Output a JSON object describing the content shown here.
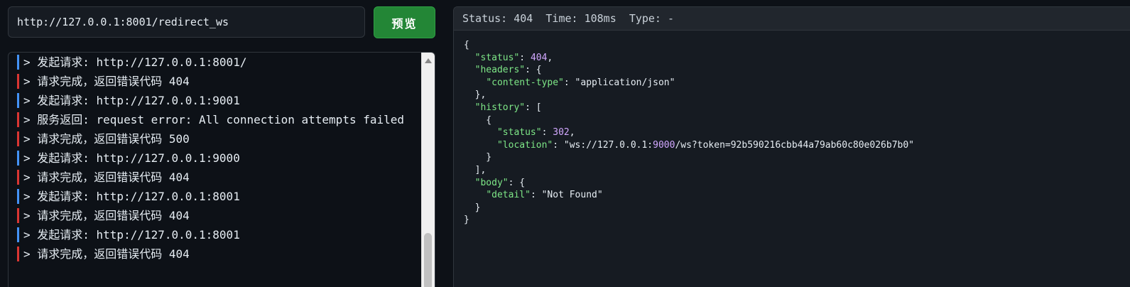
{
  "url_input": {
    "value": "http://127.0.0.1:8001/redirect_ws"
  },
  "preview_button": {
    "label": "预览"
  },
  "log": [
    {
      "type": "info",
      "text": "> 发起请求: http://127.0.0.1:8001/"
    },
    {
      "type": "error",
      "text": "> 请求完成，返回错误代码 404"
    },
    {
      "type": "info",
      "text": "> 发起请求: http://127.0.0.1:9001"
    },
    {
      "type": "error",
      "text": "> 服务返回: request error: All connection attempts failed"
    },
    {
      "type": "error",
      "text": "> 请求完成，返回错误代码 500"
    },
    {
      "type": "info",
      "text": "> 发起请求: http://127.0.0.1:9000"
    },
    {
      "type": "error",
      "text": "> 请求完成，返回错误代码 404"
    },
    {
      "type": "info",
      "text": "> 发起请求: http://127.0.0.1:8001"
    },
    {
      "type": "error",
      "text": "> 请求完成，返回错误代码 404"
    },
    {
      "type": "info",
      "text": "> 发起请求: http://127.0.0.1:8001"
    },
    {
      "type": "error",
      "text": "> 请求完成，返回错误代码 404"
    }
  ],
  "status_bar": {
    "status_label": "Status:",
    "status_value": "404",
    "time_label": "Time:",
    "time_value": "108ms",
    "type_label": "Type:",
    "type_value": "-"
  },
  "response_json": "{\n  \"status\": 404,\n  \"headers\": {\n    \"content-type\": \"application/json\"\n  },\n  \"history\": [\n    {\n      \"status\": 302,\n      \"location\": \"ws://127.0.0.1:9000/ws?token=92b590216cbb44a79ab60c80e026b7b0\"\n    }\n  ],\n  \"body\": {\n    \"detail\": \"Not Found\"\n  }\n}",
  "colors": {
    "info_bar": "#4493f8",
    "error_bar": "#da3633",
    "button": "#238636",
    "json_key": "#7ee787",
    "json_number": "#d2a8ff"
  },
  "icons": {
    "scroll_up": "triangle-up"
  }
}
